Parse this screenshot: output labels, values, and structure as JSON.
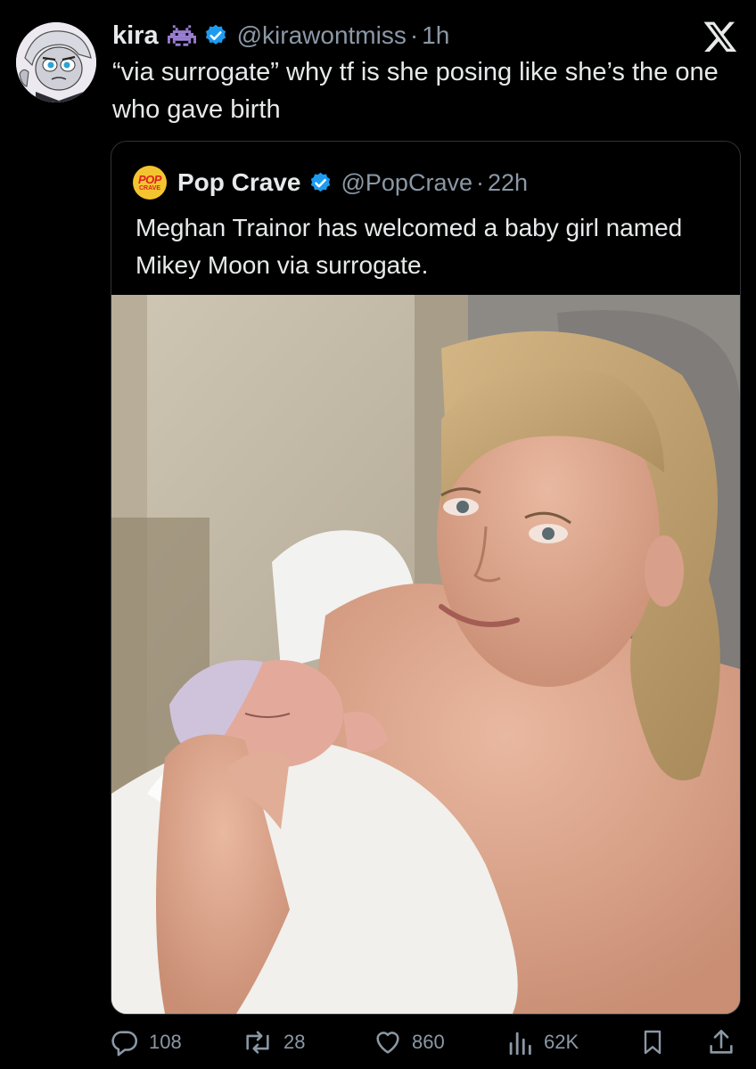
{
  "tweet": {
    "display_name": "kira",
    "name_emoji": "space-invader-emoji",
    "handle": "@kirawontmiss",
    "separator": "·",
    "time": "1h",
    "text": "“via surrogate” why tf is she posing like she’s the one who gave birth",
    "avatar": "cartoon-character-avatar"
  },
  "quoted": {
    "display_name": "Pop Crave",
    "logo_text_top": "POP",
    "logo_text_bottom": "CRAVE",
    "handle": "@PopCrave",
    "separator": "·",
    "time": "22h",
    "text": "Meghan Trainor has welcomed a baby girl named Mikey Moon via surrogate.",
    "photo": "woman-holding-newborn-in-towel"
  },
  "actions": {
    "replies": "108",
    "retweets": "28",
    "likes": "860",
    "views": "62K",
    "bookmark": "bookmark-icon",
    "share": "share-icon"
  },
  "colors": {
    "background": "#000000",
    "text": "#e7e9ea",
    "muted": "#8b98a5",
    "border": "#2f3336",
    "verified": "#1d9bf0",
    "emoji": "#9a7fd1"
  }
}
